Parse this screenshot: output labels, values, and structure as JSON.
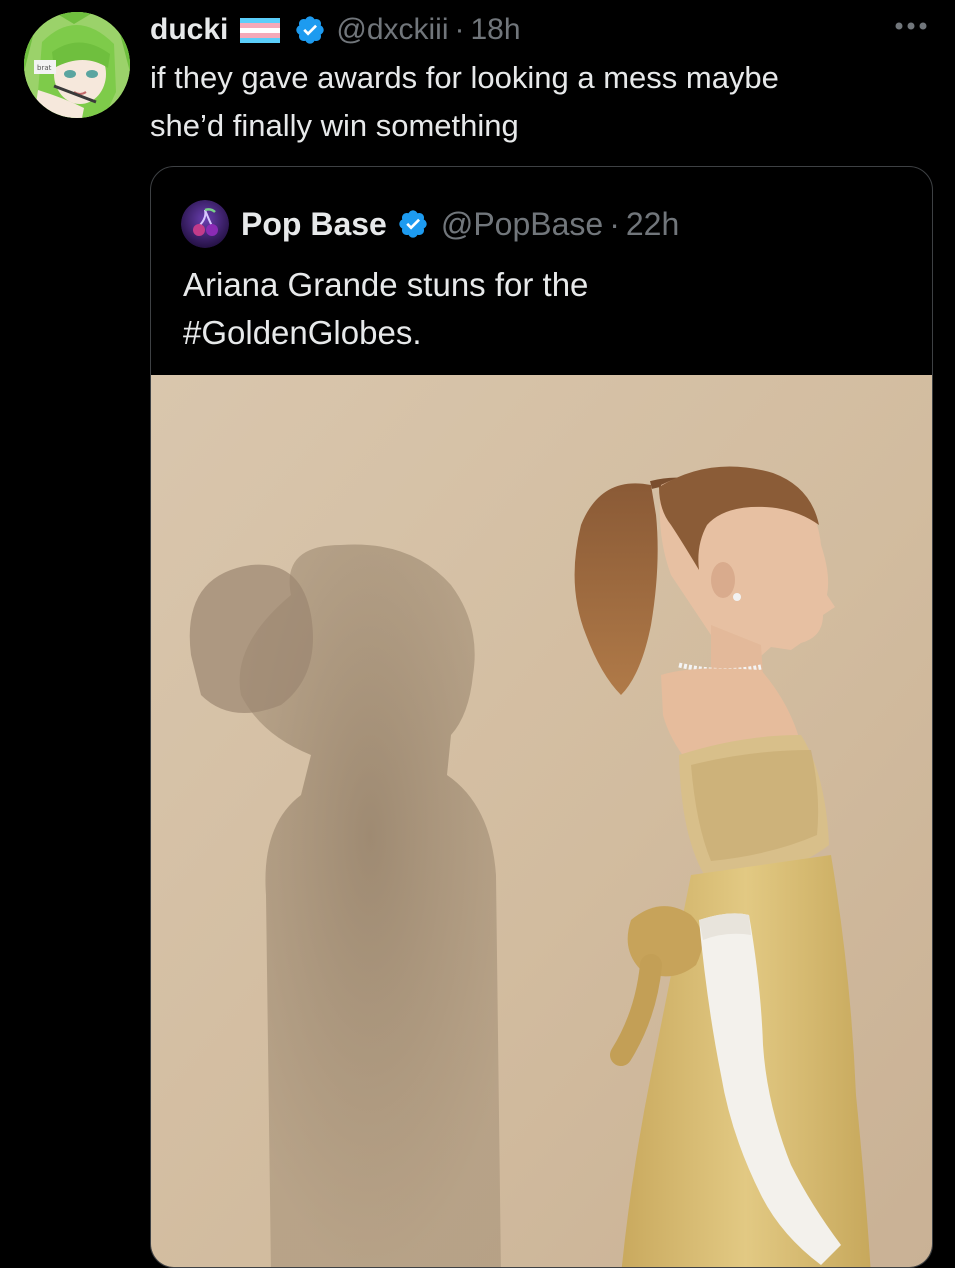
{
  "tweet": {
    "display_name": "ducki",
    "flag_icon": "transgender-flag-icon",
    "verified_icon": "verified-badge-icon",
    "handle": "@dxckiii",
    "separator": "·",
    "time": "18h",
    "more_icon": "more-options-icon",
    "text": "if they gave awards for looking a mess maybe\nshe’d finally win something",
    "avatar_badge_text": "brat"
  },
  "quote": {
    "display_name": "Pop Base",
    "verified_icon": "verified-badge-icon",
    "handle": "@PopBase",
    "separator": "·",
    "time": "22h",
    "text": "Ariana Grande stuns for the\n#GoldenGlobes.",
    "avatar_icon": "cherry-logo-icon",
    "media": "photo-woman-in-gold-gown-profile"
  },
  "colors": {
    "background": "#000000",
    "primary_text": "#e7e9ea",
    "secondary_text": "#71767b",
    "verified_blue": "#1d9bf0",
    "card_border": "#3e4144",
    "photo_backdrop": "#d3bea3"
  }
}
